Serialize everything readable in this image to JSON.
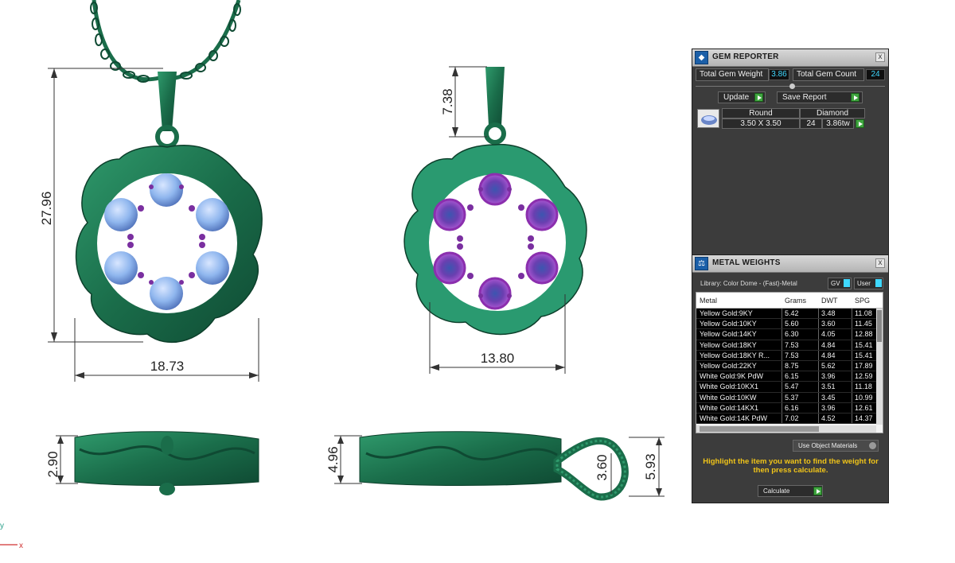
{
  "dimensions": {
    "front_height": "27.96",
    "front_width": "18.73",
    "back_bail_height": "7.38",
    "back_width": "13.80",
    "side_height": "2.90",
    "side2_height": "4.96",
    "bail_inner": "3.60",
    "bail_outer": "5.93"
  },
  "axes": {
    "y_label": "y",
    "x_label": "x"
  },
  "gem_reporter": {
    "title": "GEM REPORTER",
    "close_glyph": "x",
    "total_weight_label": "Total Gem Weight",
    "total_weight_value": "3.86",
    "total_count_label": "Total Gem Count",
    "total_count_value": "24",
    "update_label": "Update",
    "save_report_label": "Save Report",
    "gems": [
      {
        "shape": "Round",
        "size": "3.50 X 3.50",
        "material": "Diamond",
        "count": "24",
        "weight": "3.86tw"
      }
    ]
  },
  "metal_weights": {
    "title": "METAL WEIGHTS",
    "close_glyph": "x",
    "library_label": "Library: Color Dome - (Fast)-Metal",
    "gv_label": "GV",
    "user_label": "User",
    "columns": [
      "Metal",
      "Grams",
      "DWT",
      "SPG"
    ],
    "rows": [
      {
        "metal": "Yellow Gold:9KY",
        "grams": "5.42",
        "dwt": "3.48",
        "spg": "11.08"
      },
      {
        "metal": "Yellow Gold:10KY",
        "grams": "5.60",
        "dwt": "3.60",
        "spg": "11.45"
      },
      {
        "metal": "Yellow Gold:14KY",
        "grams": "6.30",
        "dwt": "4.05",
        "spg": "12.88"
      },
      {
        "metal": "Yellow Gold:18KY",
        "grams": "7.53",
        "dwt": "4.84",
        "spg": "15.41"
      },
      {
        "metal": "Yellow Gold:18KY R...",
        "grams": "7.53",
        "dwt": "4.84",
        "spg": "15.41"
      },
      {
        "metal": "Yellow Gold:22KY",
        "grams": "8.75",
        "dwt": "5.62",
        "spg": "17.89"
      },
      {
        "metal": "White Gold:9K PdW",
        "grams": "6.15",
        "dwt": "3.96",
        "spg": "12.59"
      },
      {
        "metal": "White Gold:10KX1",
        "grams": "5.47",
        "dwt": "3.51",
        "spg": "11.18"
      },
      {
        "metal": "White Gold:10KW",
        "grams": "5.37",
        "dwt": "3.45",
        "spg": "10.99"
      },
      {
        "metal": "White Gold:14KX1",
        "grams": "6.16",
        "dwt": "3.96",
        "spg": "12.61"
      },
      {
        "metal": "White Gold:14K PdW",
        "grams": "7.02",
        "dwt": "4.52",
        "spg": "14.37"
      }
    ],
    "use_object_materials_label": "Use Object Materials",
    "hint": "Highlight the item you want to find the weight for then press calculate.",
    "calculate_label": "Calculate"
  },
  "colors": {
    "metal_green": "#1f7a55",
    "gem_blue": "#8fb6ee",
    "gem_purple": "#a24cc2",
    "panel_bg": "#3c3c3c",
    "value_cyan": "#3fd8ff",
    "hint_yellow": "#f0c419"
  }
}
